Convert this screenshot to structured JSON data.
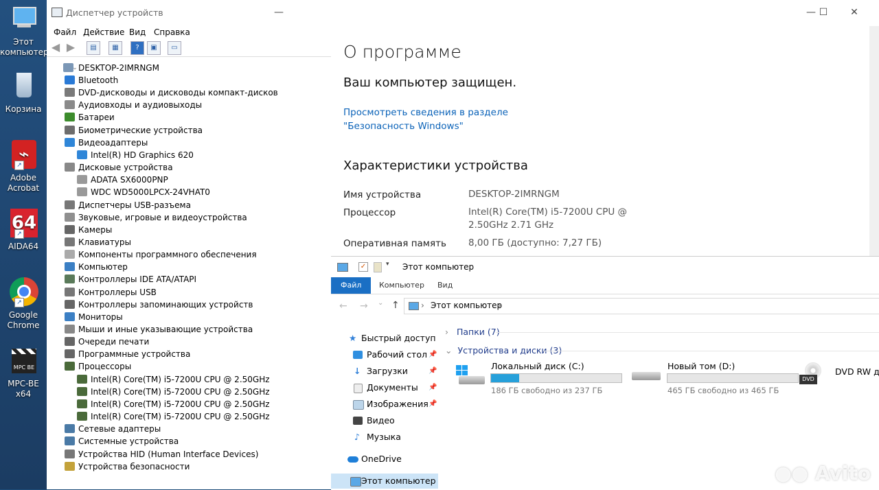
{
  "desktop": {
    "icons": [
      {
        "label": "Этот компьютер"
      },
      {
        "label": "Корзина"
      },
      {
        "label": "Adobe Acrobat"
      },
      {
        "label": "AIDA64",
        "badge": "64"
      },
      {
        "label": "Google Chrome"
      },
      {
        "label": "MPC-BE x64",
        "badge": "MPC BE"
      }
    ]
  },
  "devmgr": {
    "title": "Диспетчер устройств",
    "menu": [
      "Файл",
      "Действие",
      "Вид",
      "Справка"
    ],
    "root": "DESKTOP-2IMRNGM",
    "tree": [
      {
        "label": "Bluetooth",
        "expanded": false,
        "level": 1
      },
      {
        "label": "DVD-дисководы и дисководы компакт-дисков",
        "expanded": false,
        "level": 1
      },
      {
        "label": "Аудиовходы и аудиовыходы",
        "expanded": false,
        "level": 1
      },
      {
        "label": "Батареи",
        "expanded": false,
        "level": 1
      },
      {
        "label": "Биометрические устройства",
        "expanded": false,
        "level": 1
      },
      {
        "label": "Видеоадаптеры",
        "expanded": true,
        "level": 1
      },
      {
        "label": "Intel(R) HD Graphics 620",
        "level": 2
      },
      {
        "label": "Дисковые устройства",
        "expanded": true,
        "level": 1
      },
      {
        "label": "ADATA SX6000PNP",
        "level": 2
      },
      {
        "label": "WDC WD5000LPCX-24VHAT0",
        "level": 2
      },
      {
        "label": "Диспетчеры USB-разъема",
        "expanded": false,
        "level": 1
      },
      {
        "label": "Звуковые, игровые и видеоустройства",
        "expanded": false,
        "level": 1
      },
      {
        "label": "Камеры",
        "expanded": false,
        "level": 1
      },
      {
        "label": "Клавиатуры",
        "expanded": false,
        "level": 1
      },
      {
        "label": "Компоненты программного обеспечения",
        "expanded": false,
        "level": 1
      },
      {
        "label": "Компьютер",
        "expanded": false,
        "level": 1
      },
      {
        "label": "Контроллеры IDE ATA/ATAPI",
        "expanded": false,
        "level": 1
      },
      {
        "label": "Контроллеры USB",
        "expanded": false,
        "level": 1
      },
      {
        "label": "Контроллеры запоминающих устройств",
        "expanded": false,
        "level": 1
      },
      {
        "label": "Мониторы",
        "expanded": false,
        "level": 1
      },
      {
        "label": "Мыши и иные указывающие устройства",
        "expanded": false,
        "level": 1
      },
      {
        "label": "Очереди печати",
        "expanded": false,
        "level": 1
      },
      {
        "label": "Программные устройства",
        "expanded": false,
        "level": 1
      },
      {
        "label": "Процессоры",
        "expanded": true,
        "level": 1
      },
      {
        "label": "Intel(R) Core(TM) i5-7200U CPU @ 2.50GHz",
        "level": 2
      },
      {
        "label": "Intel(R) Core(TM) i5-7200U CPU @ 2.50GHz",
        "level": 2
      },
      {
        "label": "Intel(R) Core(TM) i5-7200U CPU @ 2.50GHz",
        "level": 2
      },
      {
        "label": "Intel(R) Core(TM) i5-7200U CPU @ 2.50GHz",
        "level": 2
      },
      {
        "label": "Сетевые адаптеры",
        "expanded": false,
        "level": 1
      },
      {
        "label": "Системные устройства",
        "expanded": false,
        "level": 1
      },
      {
        "label": "Устройства HID (Human Interface Devices)",
        "expanded": false,
        "level": 1
      },
      {
        "label": "Устройства безопасности",
        "expanded": false,
        "level": 1
      }
    ]
  },
  "about": {
    "heading": "О программе",
    "protected": "Ваш компьютер защищен.",
    "link": "Просмотреть сведения в разделе \"Безопасность Windows\"",
    "specs_heading": "Характеристики устройства",
    "specs": [
      {
        "key": "Имя устройства",
        "value": "DESKTOP-2IMRNGM"
      },
      {
        "key": "Процессор",
        "value": "Intel(R) Core(TM) i5-7200U CPU @ 2.50GHz 2.71 GHz"
      },
      {
        "key": "Оперативная память",
        "value": "8,00 ГБ (доступно: 7,27 ГБ)"
      }
    ]
  },
  "explorer": {
    "title": "Этот компьютер",
    "tabs": [
      "Файл",
      "Компьютер",
      "Вид"
    ],
    "address": "Этот компьютер",
    "nav": [
      {
        "label": "Быстрый доступ",
        "pinned": false
      },
      {
        "label": "Рабочий стол",
        "pinned": true
      },
      {
        "label": "Загрузки",
        "pinned": true
      },
      {
        "label": "Документы",
        "pinned": true
      },
      {
        "label": "Изображения",
        "pinned": true
      },
      {
        "label": "Видео",
        "pinned": false
      },
      {
        "label": "Музыка",
        "pinned": false
      },
      {
        "label": "OneDrive",
        "pinned": false
      },
      {
        "label": "Этот компьютер",
        "pinned": false
      }
    ],
    "folders_group": "Папки (7)",
    "drives_group": "Устройства и диски (3)",
    "drives": [
      {
        "name": "Локальный диск (C:)",
        "free": "186 ГБ свободно из 237 ГБ",
        "used_fraction": 0.215
      },
      {
        "name": "Новый том (D:)",
        "free": "465 ГБ свободно из 465 ГБ",
        "used_fraction": 0.0
      },
      {
        "name": "DVD RW д",
        "dvd": "DVD"
      }
    ]
  },
  "watermark": "Avito",
  "colors": {
    "accent": "#1a6fc4",
    "link": "#0a62b8",
    "drive_fill": "#26a0da"
  }
}
